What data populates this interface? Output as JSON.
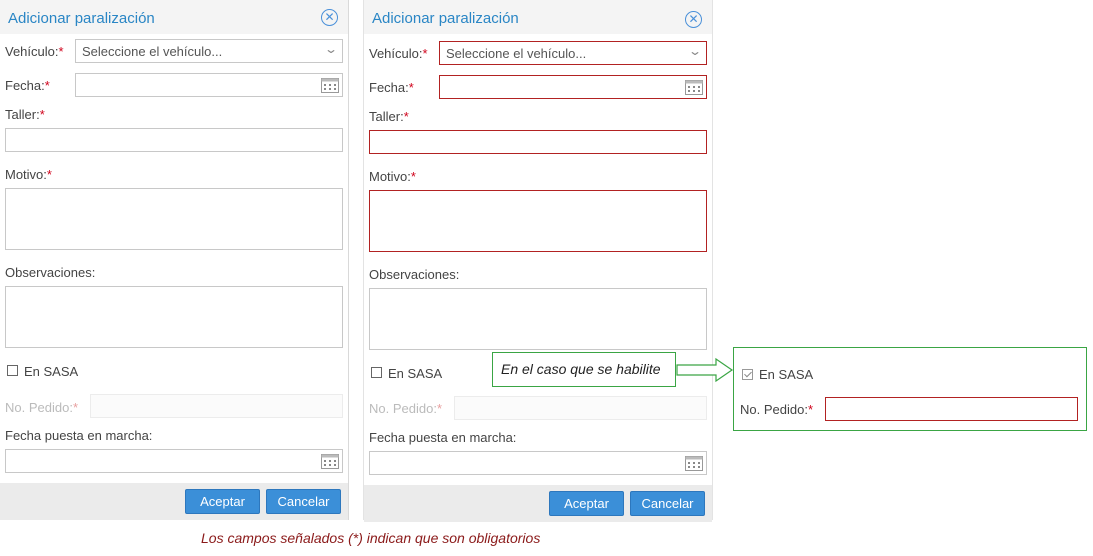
{
  "left_dialog": {
    "title": "Adicionar paralización",
    "close_icon": "close-circle-icon",
    "vehicle_label": "Vehículo:",
    "vehicle_placeholder": "Seleccione el vehículo...",
    "date_label": "Fecha:",
    "workshop_label": "Taller:",
    "reason_label": "Motivo:",
    "observations_label": "Observaciones:",
    "sasa_label": "En SASA",
    "sasa_checked": false,
    "order_label": "No. Pedido:",
    "startup_date_label": "Fecha puesta en marcha:",
    "accept_label": "Aceptar",
    "cancel_label": "Cancelar",
    "required_mark": "*"
  },
  "right_dialog": {
    "title": "Adicionar paralización",
    "close_icon": "close-circle-icon",
    "vehicle_label": "Vehículo:",
    "vehicle_placeholder": "Seleccione el vehículo...",
    "date_label": "Fecha:",
    "workshop_label": "Taller:",
    "reason_label": "Motivo:",
    "observations_label": "Observaciones:",
    "sasa_label": "En SASA",
    "sasa_checked": false,
    "order_label": "No. Pedido:",
    "startup_date_label": "Fecha puesta en marcha:",
    "accept_label": "Aceptar",
    "cancel_label": "Cancelar",
    "required_mark": "*"
  },
  "annotation": {
    "callout_text": "En el caso que se habilite",
    "enabled_sasa_label": "En SASA",
    "enabled_sasa_checked": true,
    "enabled_order_label": "No. Pedido:",
    "required_mark": "*",
    "footnote": "Los campos señalados (*) indican que son obligatorios"
  },
  "colors": {
    "title_blue": "#2a86c5",
    "button_blue": "#3b8fd8",
    "required_red": "#d0021b",
    "invalid_border": "#b22222",
    "callout_green": "#3aa544",
    "footnote_red": "#8b1a1a"
  }
}
